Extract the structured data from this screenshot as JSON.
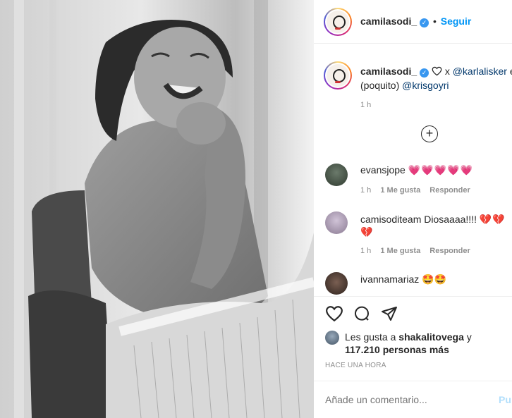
{
  "post": {
    "username": "camilasodi_",
    "follow_label": "Seguir",
    "dot": "•",
    "caption_prefix": "x",
    "mention_1": "@karlalisker",
    "caption_tail": "en",
    "caption_line2_a": "(poquito)",
    "mention_2": "@krisgoyri",
    "time": "1 h"
  },
  "icons": {
    "verified": "verified-badge-icon",
    "heart_outline": "heart-outline-icon",
    "comment": "comment-bubble-icon",
    "share": "paper-plane-icon",
    "load_more": "plus-circle-icon"
  },
  "comments": [
    {
      "user": "evansjope",
      "text": "💗💗💗💗💗",
      "time": "1 h",
      "likes": "1 Me gusta",
      "reply": "Responder"
    },
    {
      "user": "camisoditeam",
      "text": "Diosaaaa!!!!",
      "emoji": "💔💔",
      "emoji2": "💔",
      "time": "1 h",
      "likes": "1 Me gusta",
      "reply": "Responder"
    },
    {
      "user": "ivannamariaz",
      "text": "🤩🤩"
    }
  ],
  "likes": {
    "prefix": "Les gusta a",
    "user": "shakalitovega",
    "and": "y",
    "count": "117.210 personas más"
  },
  "timestamp": "HACE UNA HORA",
  "comment_box": {
    "placeholder": "Añade un comentario...",
    "publish": "Pu"
  },
  "colors": {
    "accent": "#0095f6",
    "heart": "#e0245e",
    "text": "#262626",
    "muted": "#8e8e8e"
  }
}
